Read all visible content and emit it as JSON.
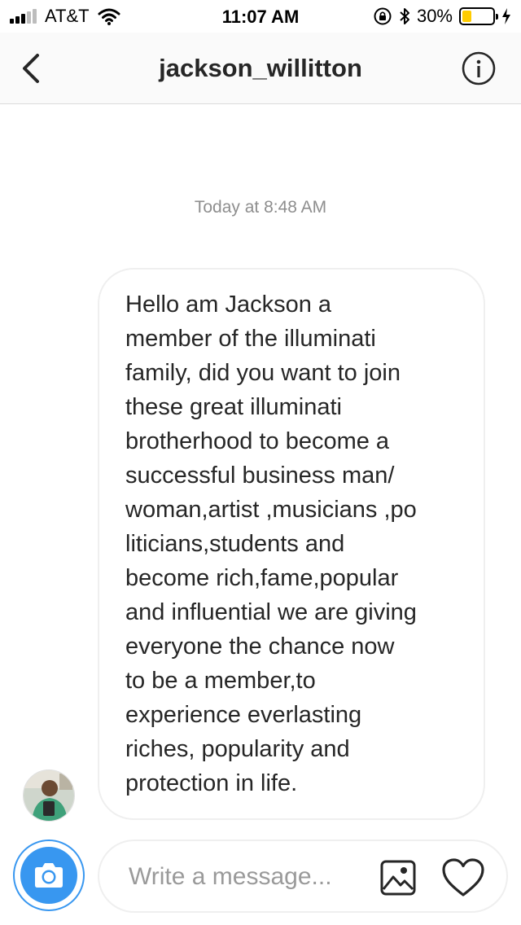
{
  "status_bar": {
    "carrier": "AT&T",
    "time": "11:07 AM",
    "battery_percent": "30%",
    "battery_level": 0.3,
    "icons": [
      "signal-icon",
      "wifi-icon",
      "orientation-lock-icon",
      "bluetooth-icon",
      "battery-icon",
      "charging-icon"
    ]
  },
  "header": {
    "title": "jackson_willitton",
    "back_icon": "chevron-left-icon",
    "info_icon": "info-icon"
  },
  "thread": {
    "timestamp": "Today at 8:48 AM",
    "messages": [
      {
        "sender": "jackson_willitton",
        "lines": [
          "Hello am Jackson a",
          "member of the illuminati",
          "family, did you want to join",
          "these great illuminati",
          "brotherhood to become a",
          "successful business man/",
          "woman,artist ,musicians ,po",
          "liticians,students and",
          "become rich,fame,popular",
          "and influential we are giving",
          "everyone the chance now",
          "to be a member,to",
          "experience everlasting",
          "riches, popularity and",
          "protection in life."
        ]
      }
    ]
  },
  "composer": {
    "placeholder": "Write a message...",
    "value": "",
    "camera_icon": "camera-icon",
    "gallery_icon": "image-icon",
    "like_icon": "heart-icon"
  },
  "colors": {
    "accent": "#3897f0",
    "battery": "#ffcc00",
    "divider": "#dbdbdb",
    "timestamp_text": "#8e8e8e"
  }
}
